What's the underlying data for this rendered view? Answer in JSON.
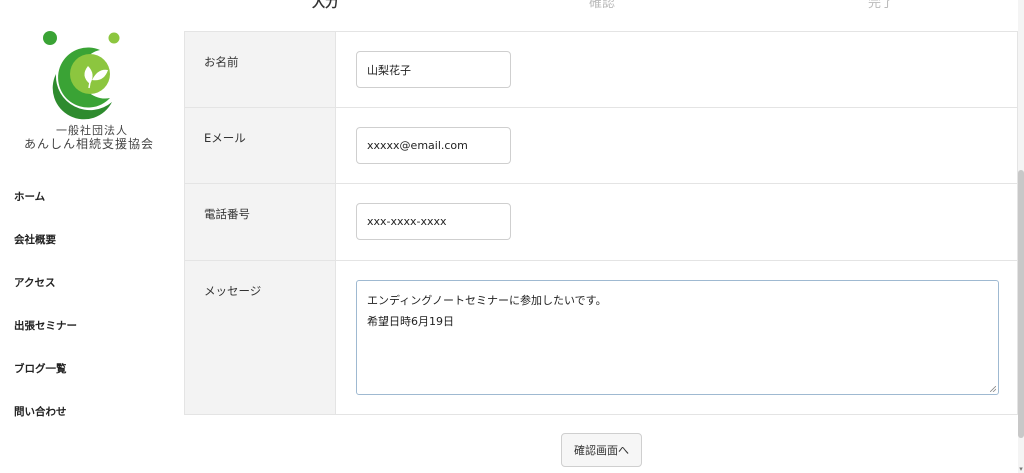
{
  "steps": [
    "入力",
    "確認",
    "完了"
  ],
  "organization": {
    "line1": "一般社団法人",
    "line2": "あんしん相続支援協会"
  },
  "nav": [
    "ホーム",
    "会社概要",
    "アクセス",
    "出張セミナー",
    "ブログ一覧",
    "問い合わせ"
  ],
  "form": {
    "name": {
      "label": "お名前",
      "value": "山梨花子"
    },
    "email": {
      "label": "Eメール",
      "value": "xxxxx@email.com"
    },
    "phone": {
      "label": "電話番号",
      "value": "xxx-xxxx-xxxx"
    },
    "message": {
      "label": "メッセージ",
      "line1": "エンディングノートセミナーに参加したいです。",
      "line2": "希望日時6月19日"
    },
    "submit_label": "確認画面へ"
  },
  "colors": {
    "logo_green": "#3aa335",
    "logo_light_green": "#8cc63f",
    "textarea_border": "#9fb9d1"
  }
}
